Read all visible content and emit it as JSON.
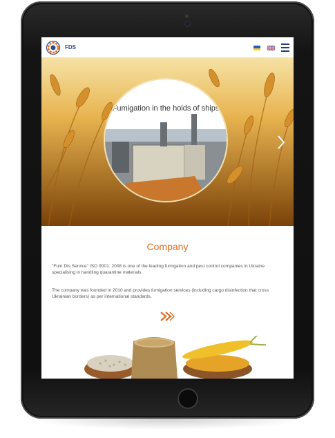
{
  "header": {
    "brand": "FDS",
    "menu_icon": "hamburger-icon",
    "languages": [
      "ua",
      "en"
    ]
  },
  "hero": {
    "slide_title": "Fumigation in the holds of ships",
    "next_icon": "chevron-right-icon"
  },
  "company": {
    "title": "Company",
    "paragraphs": [
      "\"Fum Dis Service\" ISO 9001: 2008 is one of the leading fumigation and pest control companies in Ukraine specialising in handling quarantine materials.",
      "The company was founded in 2010 and provides fumigation services (including cargo disinfection that cross Ukrainian borders) as per international standards."
    ],
    "more_icon": "double-chevron-right-icon"
  },
  "colors": {
    "accent": "#e46a1c",
    "brand": "#2a4a8a"
  }
}
